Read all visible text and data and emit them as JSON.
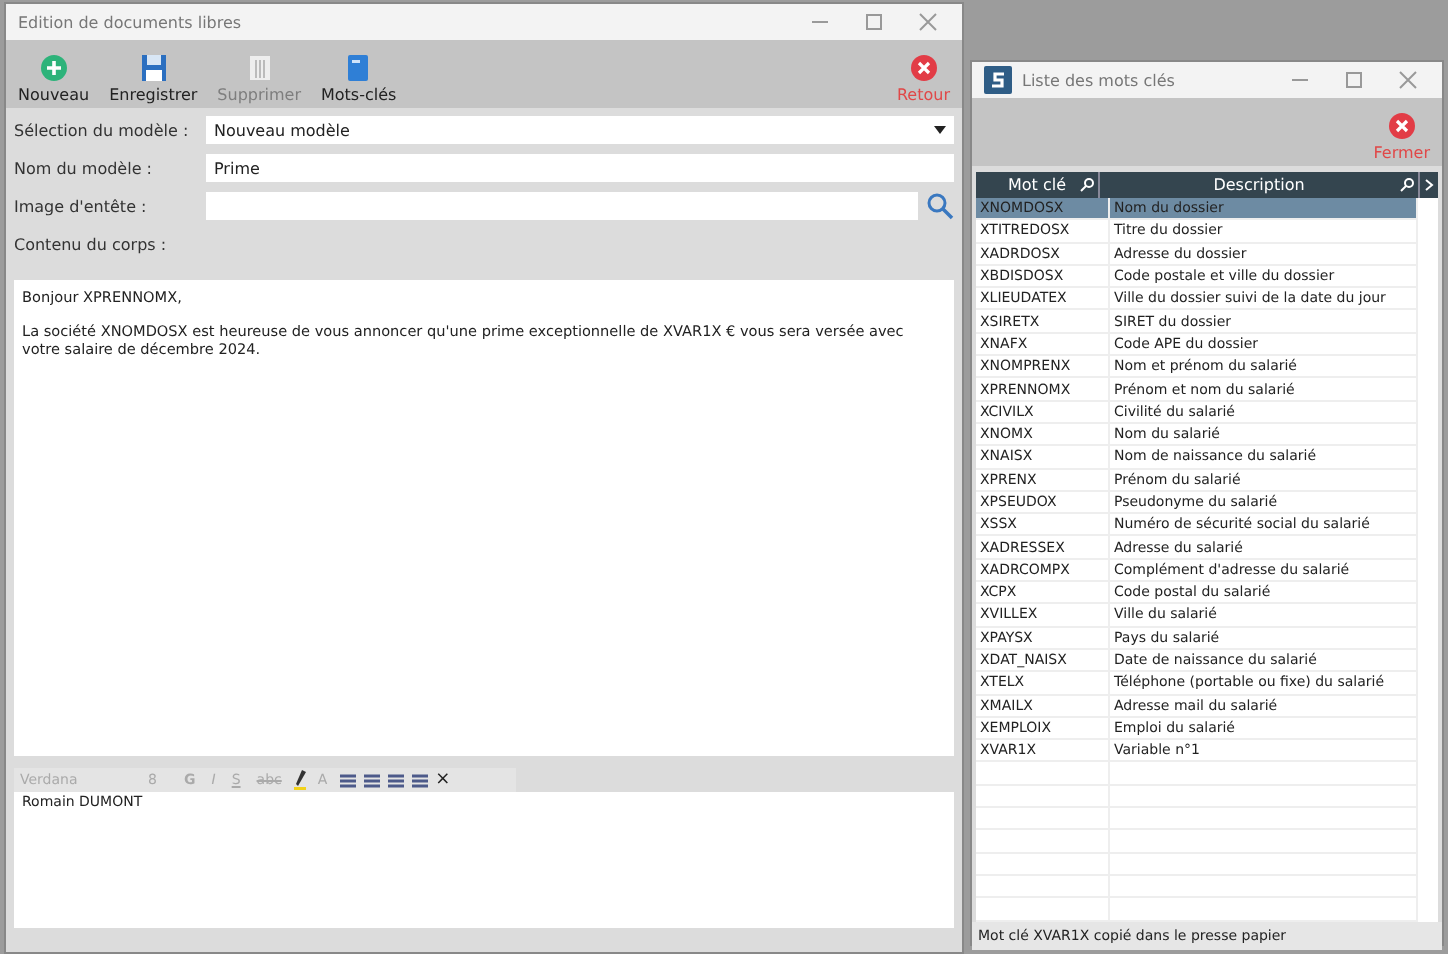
{
  "main_window": {
    "title": "Edition de documents libres",
    "toolbar": [
      {
        "label": "Nouveau",
        "kind": "new",
        "disabled": false
      },
      {
        "label": "Enregistrer",
        "kind": "save",
        "disabled": false
      },
      {
        "label": "Supprimer",
        "kind": "delete",
        "disabled": true
      },
      {
        "label": "Mots-clés",
        "kind": "keywords",
        "disabled": false
      }
    ],
    "close_button": {
      "label": "Retour"
    },
    "fields": [
      {
        "label": "Sélection du modèle :",
        "kind": "select",
        "value": "Nouveau modèle"
      },
      {
        "label": "Nom du modèle :",
        "kind": "text",
        "value": "Prime"
      },
      {
        "label": "Image d'entête :",
        "kind": "search"
      },
      {
        "label": "Contenu du corps :",
        "kind": "label"
      }
    ],
    "body": [
      "Bonjour XPRENNOMX,",
      "La société XNOMDOSX est heureuse de vous annoncer qu'une prime exceptionnelle de XVAR1X € vous sera versée avec votre salaire de décembre 2024."
    ],
    "signature_editor": {
      "font": "Verdana",
      "size": "8",
      "format_buttons": [
        {
          "label": "G",
          "kind": "bold"
        },
        {
          "label": "I",
          "kind": "italic"
        },
        {
          "label": "S",
          "kind": "underline"
        },
        {
          "label": "abc",
          "kind": "strike"
        }
      ],
      "color_label": "A",
      "close": "×",
      "text": "Romain DUMONT"
    }
  },
  "keywords_window": {
    "title": "Liste des mots clés",
    "close_button": {
      "label": "Fermer"
    },
    "columns": [
      "Mot clé",
      "Description"
    ],
    "rows": [
      {
        "key": "XNOMDOSX",
        "description": "Nom du dossier",
        "selected": true
      },
      {
        "key": "XTITREDOSX",
        "description": "Titre du dossier",
        "selected": false
      },
      {
        "key": "XADRDOSX",
        "description": "Adresse du dossier",
        "selected": false
      },
      {
        "key": "XBDISDOSX",
        "description": "Code postale et ville du dossier",
        "selected": false
      },
      {
        "key": "XLIEUDATEX",
        "description": "Ville du dossier suivi de la date du jour",
        "selected": false
      },
      {
        "key": "XSIRETX",
        "description": "SIRET du dossier",
        "selected": false
      },
      {
        "key": "XNAFX",
        "description": "Code APE du dossier",
        "selected": false
      },
      {
        "key": "XNOMPRENX",
        "description": "Nom et prénom du salarié",
        "selected": false
      },
      {
        "key": "XPRENNOMX",
        "description": "Prénom et nom du salarié",
        "selected": false
      },
      {
        "key": "XCIVILX",
        "description": "Civilité du salarié",
        "selected": false
      },
      {
        "key": "XNOMX",
        "description": "Nom du salarié",
        "selected": false
      },
      {
        "key": "XNAISX",
        "description": "Nom de naissance du salarié",
        "selected": false
      },
      {
        "key": "XPRENX",
        "description": "Prénom du salarié",
        "selected": false
      },
      {
        "key": "XPSEUDOX",
        "description": "Pseudonyme du salarié",
        "selected": false
      },
      {
        "key": "XSSX",
        "description": "Numéro de sécurité social du salarié",
        "selected": false
      },
      {
        "key": "XADRESSEX",
        "description": "Adresse du salarié",
        "selected": false
      },
      {
        "key": "XADRCOMPX",
        "description": "Complément d'adresse du salarié",
        "selected": false
      },
      {
        "key": "XCPX",
        "description": "Code postal du salarié",
        "selected": false
      },
      {
        "key": "XVILLEX",
        "description": "Ville du salarié",
        "selected": false
      },
      {
        "key": "XPAYSX",
        "description": "Pays du salarié",
        "selected": false
      },
      {
        "key": "XDAT_NAISX",
        "description": "Date de naissance du salarié",
        "selected": false
      },
      {
        "key": "XTELX",
        "description": "Téléphone (portable ou fixe) du salarié",
        "selected": false
      },
      {
        "key": "XMAILX",
        "description": "Adresse mail du salarié",
        "selected": false
      },
      {
        "key": "XEMPLOIX",
        "description": "Emploi du salarié",
        "selected": false
      },
      {
        "key": "XVAR1X",
        "description": "Variable n°1",
        "selected": false
      }
    ],
    "status": "Mot clé XVAR1X copié dans le presse papier"
  }
}
